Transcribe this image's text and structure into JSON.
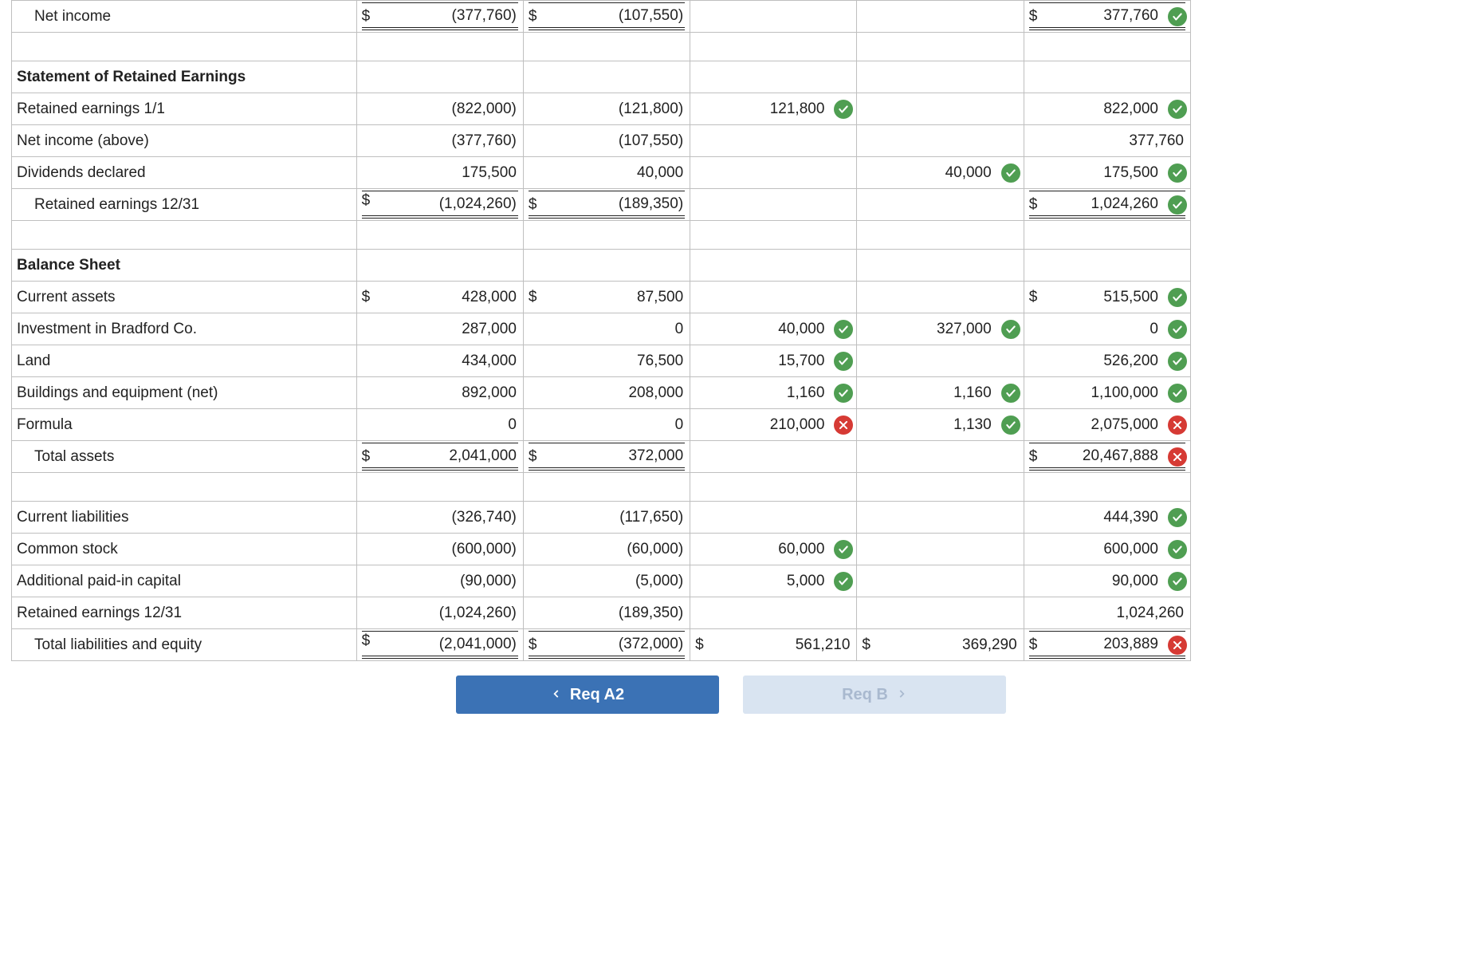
{
  "rows": [
    {
      "type": "data",
      "indent": true,
      "label": "Net income",
      "c1": {
        "dollar": true,
        "value": "(377,760)",
        "dbl": true
      },
      "c2": {
        "dollar": true,
        "value": "(107,550)",
        "dbl": true
      },
      "c3": {},
      "c4": {},
      "c5": {
        "dollar": true,
        "value": "377,760",
        "mark": "correct",
        "dbl": true
      }
    },
    {
      "type": "spacer"
    },
    {
      "type": "section",
      "label": "Statement of Retained Earnings"
    },
    {
      "type": "data",
      "label": "Retained earnings 1/1",
      "c1": {
        "value": "(822,000)"
      },
      "c2": {
        "value": "(121,800)"
      },
      "c3": {
        "value": "121,800",
        "mark": "correct"
      },
      "c4": {},
      "c5": {
        "value": "822,000",
        "mark": "correct"
      }
    },
    {
      "type": "data",
      "label": "Net income (above)",
      "c1": {
        "value": "(377,760)"
      },
      "c2": {
        "value": "(107,550)"
      },
      "c3": {},
      "c4": {},
      "c5": {
        "value": "377,760"
      }
    },
    {
      "type": "data",
      "label": "Dividends declared",
      "c1": {
        "value": "175,500"
      },
      "c2": {
        "value": "40,000"
      },
      "c3": {},
      "c4": {
        "value": "40,000",
        "mark": "correct"
      },
      "c5": {
        "value": "175,500",
        "mark": "correct"
      }
    },
    {
      "type": "data",
      "indent": true,
      "label": "Retained earnings 12/31",
      "c1": {
        "dollar": true,
        "value": "(1,024,260)",
        "twoLine": true,
        "dbl": true
      },
      "c2": {
        "dollar": true,
        "value": "(189,350)",
        "dbl": true
      },
      "c3": {},
      "c4": {},
      "c5": {
        "dollar": true,
        "value": "1,024,260",
        "mark": "correct",
        "dbl": true
      }
    },
    {
      "type": "spacer"
    },
    {
      "type": "section",
      "label": "Balance Sheet"
    },
    {
      "type": "data",
      "label": "Current assets",
      "c1": {
        "dollar": true,
        "value": "428,000"
      },
      "c2": {
        "dollar": true,
        "value": "87,500"
      },
      "c3": {},
      "c4": {},
      "c5": {
        "dollar": true,
        "value": "515,500",
        "mark": "correct"
      }
    },
    {
      "type": "data",
      "label": "Investment in Bradford Co.",
      "c1": {
        "value": "287,000"
      },
      "c2": {
        "value": "0"
      },
      "c3": {
        "value": "40,000",
        "mark": "correct"
      },
      "c4": {
        "value": "327,000",
        "mark": "correct"
      },
      "c5": {
        "value": "0",
        "mark": "correct"
      }
    },
    {
      "type": "data",
      "label": "Land",
      "c1": {
        "value": "434,000"
      },
      "c2": {
        "value": "76,500"
      },
      "c3": {
        "value": "15,700",
        "mark": "correct"
      },
      "c4": {},
      "c5": {
        "value": "526,200",
        "mark": "correct"
      }
    },
    {
      "type": "data",
      "label": "Buildings and equipment (net)",
      "c1": {
        "value": "892,000"
      },
      "c2": {
        "value": "208,000"
      },
      "c3": {
        "value": "1,160",
        "mark": "correct"
      },
      "c4": {
        "value": "1,160",
        "mark": "correct"
      },
      "c5": {
        "value": "1,100,000",
        "mark": "correct"
      }
    },
    {
      "type": "data",
      "label": "Formula",
      "c1": {
        "value": "0"
      },
      "c2": {
        "value": "0"
      },
      "c3": {
        "value": "210,000",
        "mark": "incorrect"
      },
      "c4": {
        "value": "1,130",
        "mark": "correct"
      },
      "c5": {
        "value": "2,075,000",
        "mark": "incorrect"
      }
    },
    {
      "type": "data",
      "indent": true,
      "label": "Total assets",
      "c1": {
        "dollar": true,
        "value": "2,041,000",
        "dbl": true
      },
      "c2": {
        "dollar": true,
        "value": "372,000",
        "dbl": true
      },
      "c3": {},
      "c4": {},
      "c5": {
        "dollar": true,
        "value": "20,467,888",
        "mark": "incorrect",
        "dbl": true
      }
    },
    {
      "type": "spacer"
    },
    {
      "type": "data",
      "label": "Current liabilities",
      "c1": {
        "value": "(326,740)"
      },
      "c2": {
        "value": "(117,650)"
      },
      "c3": {},
      "c4": {},
      "c5": {
        "value": "444,390",
        "mark": "correct"
      }
    },
    {
      "type": "data",
      "label": "Common stock",
      "c1": {
        "value": "(600,000)"
      },
      "c2": {
        "value": "(60,000)"
      },
      "c3": {
        "value": "60,000",
        "mark": "correct"
      },
      "c4": {},
      "c5": {
        "value": "600,000",
        "mark": "correct"
      }
    },
    {
      "type": "data",
      "label": "Additional paid-in capital",
      "c1": {
        "value": "(90,000)"
      },
      "c2": {
        "value": "(5,000)"
      },
      "c3": {
        "value": "5,000",
        "mark": "correct"
      },
      "c4": {},
      "c5": {
        "value": "90,000",
        "mark": "correct"
      }
    },
    {
      "type": "data",
      "label": "Retained earnings 12/31",
      "c1": {
        "value": "(1,024,260)"
      },
      "c2": {
        "value": "(189,350)"
      },
      "c3": {},
      "c4": {},
      "c5": {
        "value": "1,024,260"
      }
    },
    {
      "type": "data",
      "indent": true,
      "label": "Total liabilities and equity",
      "c1": {
        "dollar": true,
        "value": "(2,041,000)",
        "twoLine": true,
        "dbl": true
      },
      "c2": {
        "dollar": true,
        "value": "(372,000)",
        "dbl": true
      },
      "c3": {
        "dollar": true,
        "value": "561,210"
      },
      "c4": {
        "dollar": true,
        "value": "369,290"
      },
      "c5": {
        "dollar": true,
        "value": "203,889",
        "mark": "incorrect",
        "dbl": true
      }
    }
  ],
  "nav": {
    "prev": "Req A2",
    "next": "Req B"
  }
}
